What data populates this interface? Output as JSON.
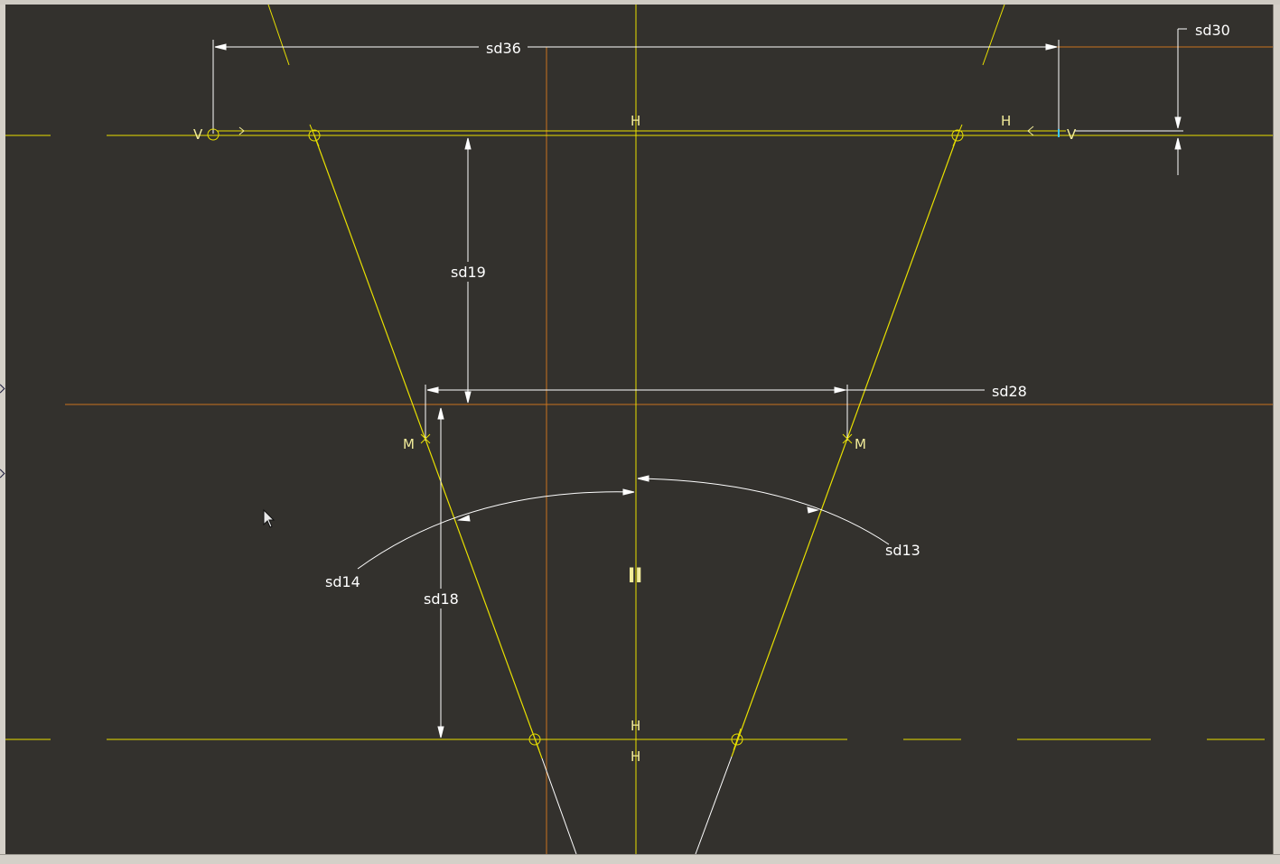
{
  "dimensions": {
    "sd36": "sd36",
    "sd30": "sd30",
    "sd19": "sd19",
    "sd28": "sd28",
    "sd14": "sd14",
    "sd13": "sd13",
    "sd18": "sd18"
  },
  "constraints": {
    "horizontal": "H",
    "vertical": "V",
    "midpoint": "M",
    "parallel": "II"
  },
  "colors": {
    "background": "#33312d",
    "geometry": "#e8e000",
    "centerline": "#d8741c",
    "dimension": "#ffffff",
    "constraint": "#f2ec9a",
    "frame": "#d4d0c8"
  }
}
